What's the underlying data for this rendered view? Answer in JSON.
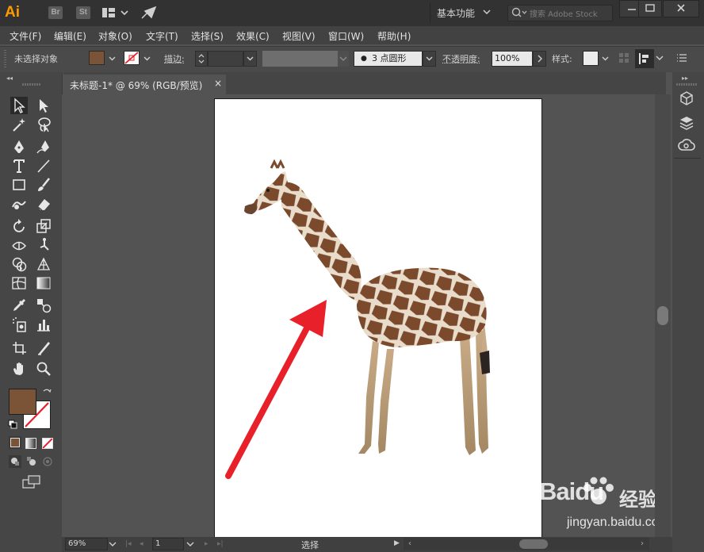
{
  "app": {
    "logo": "Ai",
    "bridge_label": "Br",
    "stock_label": "St",
    "workspace": "基本功能",
    "search_placeholder": "搜索 Adobe Stock",
    "accent_color": "#ff9a00"
  },
  "menu": [
    "文件(F)",
    "编辑(E)",
    "对象(O)",
    "文字(T)",
    "选择(S)",
    "效果(C)",
    "视图(V)",
    "窗口(W)",
    "帮助(H)"
  ],
  "control_bar": {
    "selection_status": "未选择对象",
    "fill_color": "#7b5438",
    "stroke_label": "描边",
    "brush_label": "3 点圆形",
    "opacity_label": "不透明度",
    "opacity_value": "100%",
    "style_label": "样式"
  },
  "document_tab": {
    "title": "未标题-1* @ 69% (RGB/预览)",
    "close_glyph": "×"
  },
  "toolbar": {
    "fill_color": "#7b5438",
    "icons": [
      "selection-tool",
      "direct-selection-tool",
      "magic-wand-tool",
      "lasso-tool",
      "pen-tool",
      "curvature-tool",
      "type-tool",
      "line-segment-tool",
      "rectangle-tool",
      "paintbrush-tool",
      "shaper-tool",
      "eraser-tool",
      "rotate-tool",
      "scale-tool",
      "width-tool",
      "puppet-warp-tool",
      "shape-builder-tool",
      "perspective-grid-tool",
      "mesh-tool",
      "gradient-tool",
      "eyedropper-tool",
      "blend-tool",
      "symbol-sprayer-tool",
      "column-graph-tool",
      "artboard-tool",
      "slice-tool",
      "hand-tool",
      "zoom-tool"
    ]
  },
  "status_bar": {
    "zoom": "69%",
    "artboard_number": "1",
    "tool_status": "选择"
  },
  "watermark": {
    "brand": "Baidu",
    "brand_suffix": "经验",
    "url": "jingyan.baidu.com"
  },
  "canvas": {
    "arrow_color": "#e8202a",
    "giraffe_pattern_color": "#7b4a2c",
    "giraffe_line_color": "#e9dccb"
  }
}
